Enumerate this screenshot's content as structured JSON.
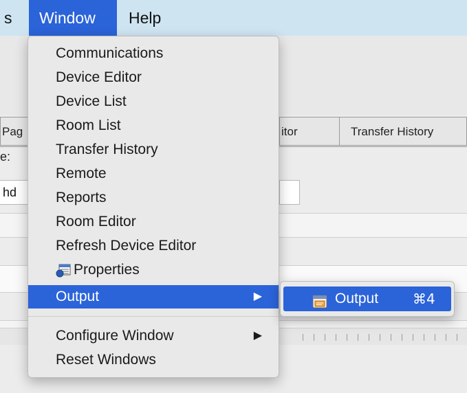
{
  "menubar": {
    "items": [
      "s",
      "Window",
      "Help"
    ]
  },
  "background": {
    "tabs": [
      "Pag",
      "itor",
      "Transfer History"
    ],
    "field_label": "e:",
    "field_value": "hd"
  },
  "window_menu": {
    "items": [
      {
        "label": "Communications"
      },
      {
        "label": "Device Editor"
      },
      {
        "label": "Device List"
      },
      {
        "label": "Room List"
      },
      {
        "label": "Transfer History"
      },
      {
        "label": "Remote"
      },
      {
        "label": "Reports"
      },
      {
        "label": "Room Editor"
      },
      {
        "label": "Refresh Device Editor"
      },
      {
        "label": "Properties",
        "icon": "properties-icon"
      },
      {
        "label": "Output",
        "submenu": true,
        "highlighted": true
      },
      {
        "label": "Configure Window",
        "submenu": true
      },
      {
        "label": "Reset Windows"
      }
    ],
    "submenu_arrow": "▶"
  },
  "output_submenu": {
    "label": "Output",
    "shortcut": "⌘4",
    "icon": "output-window-icon"
  },
  "colors": {
    "selection": "#2b63d9",
    "menubar": "#cfe4f1"
  }
}
